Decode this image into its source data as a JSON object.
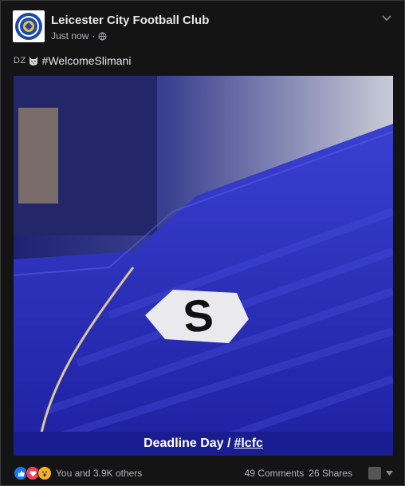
{
  "post": {
    "author": "Leicester City Football Club",
    "timestamp": "Just now",
    "privacy_icon": "globe-icon",
    "caption_prefix": "DZ",
    "caption_emoji": "cat-face",
    "caption_text": "#WelcomeSlimani",
    "image": {
      "banner_text": "Deadline Day /",
      "banner_tag": "#lcfc",
      "jersey_letter": "S"
    },
    "reactions": {
      "icons": [
        "like-icon",
        "love-icon",
        "wow-icon"
      ],
      "summary": "You and 3.9K others"
    },
    "comments": "49 Comments",
    "shares": "26 Shares"
  },
  "colors": {
    "background": "#141414",
    "jersey_blue": "#2a2fa8",
    "like": "#1877f2",
    "love": "#f33e58",
    "wow": "#f7b125"
  }
}
